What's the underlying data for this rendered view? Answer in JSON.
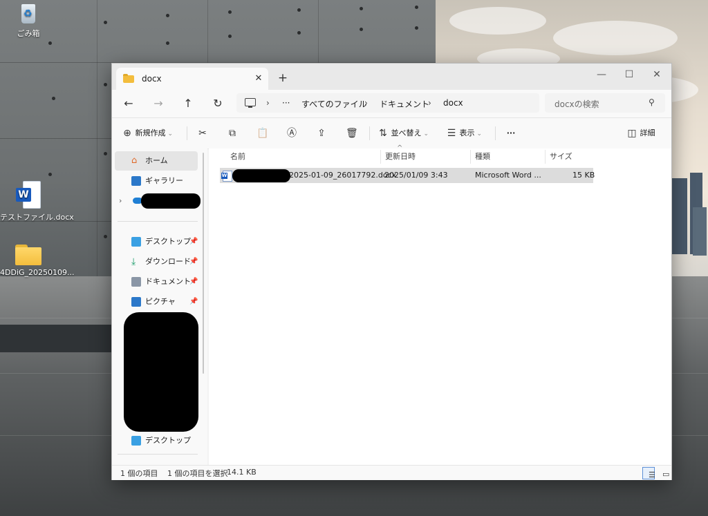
{
  "desktop": {
    "icons": [
      {
        "label": "ごみ箱",
        "icon": "recycle-bin-icon"
      },
      {
        "label": "テストファイル.docx",
        "icon": "word-document-icon"
      },
      {
        "label": "4DDiG_20250109...",
        "icon": "folder-icon"
      }
    ]
  },
  "window": {
    "tab_title": "docx",
    "tab_close": "✕",
    "new_tab": "+",
    "minimize": "—",
    "maximize": "☐",
    "close": "✕"
  },
  "nav": {
    "back": "←",
    "forward": "→",
    "up": "↑",
    "refresh": "↻",
    "more": "···",
    "breadcrumb": [
      "すべてのファイル",
      "ドキュメント",
      "docx"
    ],
    "separator": "›",
    "search_placeholder": "docxの検索"
  },
  "toolbar": {
    "new_label": "新規作成",
    "sort_label": "並べ替え",
    "view_label": "表示",
    "more": "···",
    "details_label": "詳細"
  },
  "sidebar": {
    "home": "ホーム",
    "gallery": "ギャラリー",
    "desktop": "デスクトップ",
    "downloads": "ダウンロード",
    "documents": "ドキュメント",
    "pictures": "ピクチャ",
    "desktop2": "デスクトップ",
    "expand": "›"
  },
  "columns": [
    "名前",
    "更新日時",
    "種類",
    "サイズ"
  ],
  "files": [
    {
      "name_suffix": "2025-01-09_26017792.docx",
      "modified": "2025/01/09 3:43",
      "type": "Microsoft Word ...",
      "size": "15 KB"
    }
  ],
  "status": {
    "count": "1 個の項目",
    "selected": "1 個の項目を選択",
    "size": "14.1 KB"
  },
  "colors": {
    "accent": "#185abd",
    "folder": "#f3bd3d",
    "selection": "#dcdcdc"
  }
}
